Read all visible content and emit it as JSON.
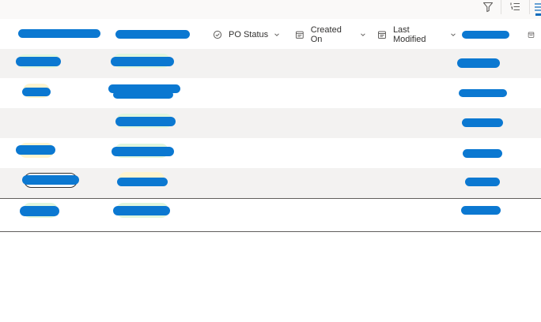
{
  "toolbar": {
    "icons": [
      "filter-icon",
      "list-ordered-icon",
      "view-layout-icon"
    ]
  },
  "columns": [
    {
      "label": "",
      "redacted": true
    },
    {
      "label": "",
      "redacted": true
    },
    {
      "label": "PO Status",
      "icon": "status-icon"
    },
    {
      "label": "Created On",
      "icon": "calendar-icon"
    },
    {
      "label": "Last Modified",
      "icon": "calendar-icon"
    },
    {
      "label": "",
      "redacted": true
    },
    {
      "label": "",
      "icon": "calendar-icon"
    }
  ],
  "colors": {
    "redaction": "#0b78d1",
    "green_badge": "#dff6dd",
    "yellow_badge": "#fff4ce",
    "alt_row": "#f3f2f1",
    "accent": "#0f6cbd"
  },
  "rows": [
    {
      "status_badge": "green"
    },
    {
      "status_badge": "yellow"
    },
    {
      "status_badge": "green"
    },
    {
      "status_badge": "yellow"
    },
    {
      "status_badge": "none"
    },
    {
      "status_badge": "green"
    }
  ]
}
